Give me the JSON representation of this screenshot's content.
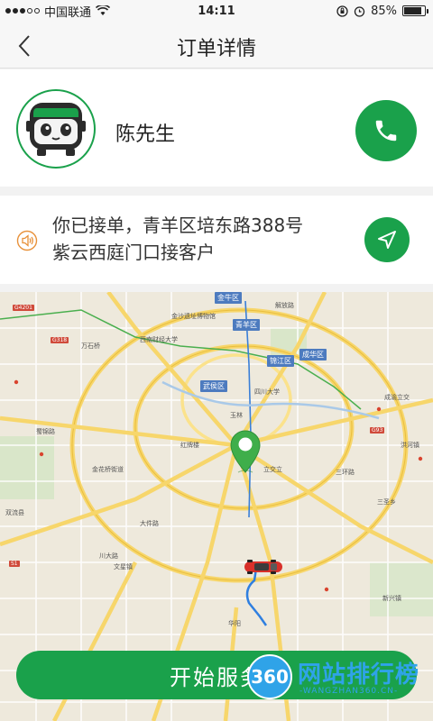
{
  "status_bar": {
    "carrier": "中国联通",
    "time": "14:11",
    "battery": "85%",
    "battery_level": 0.85
  },
  "nav": {
    "title": "订单详情",
    "back_icon": "chevron-left-icon"
  },
  "driver": {
    "name": "陈先生",
    "avatar_icon": "bus-face-icon",
    "call_icon": "phone-icon"
  },
  "notice": {
    "line1": "你已接单，青羊区培东路388号",
    "line2": "紫云西庭门口接客户",
    "speaker_icon": "speaker-icon",
    "navigate_icon": "navigation-arrow-icon"
  },
  "map": {
    "districts": [
      {
        "text": "金牛区"
      },
      {
        "text": "青羊区"
      },
      {
        "text": "成华区"
      },
      {
        "text": "锦江区"
      },
      {
        "text": "武侯区"
      }
    ],
    "labels": [
      {
        "text": "金沙遗址博物馆"
      },
      {
        "text": "西南财经大学"
      },
      {
        "text": "解放路"
      },
      {
        "text": "四川大学"
      },
      {
        "text": "玉林"
      },
      {
        "text": "红牌楼"
      },
      {
        "text": "金花桥街道"
      },
      {
        "text": "大件路"
      },
      {
        "text": "三环路"
      },
      {
        "text": "华阳"
      },
      {
        "text": "新兴镇"
      },
      {
        "text": "文星镇"
      },
      {
        "text": "双流县"
      },
      {
        "text": "三圣乡"
      },
      {
        "text": "洪河镇"
      },
      {
        "text": "成渝立交"
      },
      {
        "text": "立交立"
      },
      {
        "text": "蜀锦路"
      },
      {
        "text": "万石桥"
      },
      {
        "text": "川大路"
      }
    ],
    "road_badges": [
      "G4201",
      "G318",
      "G93",
      "S1"
    ],
    "pin_icon": "location-pin-icon",
    "car_icon": "red-car-icon"
  },
  "action": {
    "start_label": "开始服务"
  },
  "watermark": {
    "badge": "360",
    "title": "网站排行榜",
    "subtitle": "-WANGZHAN360.CN-"
  },
  "colors": {
    "accent": "#1aa14b",
    "background": "#f2f2f2",
    "district_blue": "#4d7bbf",
    "speaker_orange": "#e8913a",
    "watermark_blue": "#2fa3e8"
  }
}
